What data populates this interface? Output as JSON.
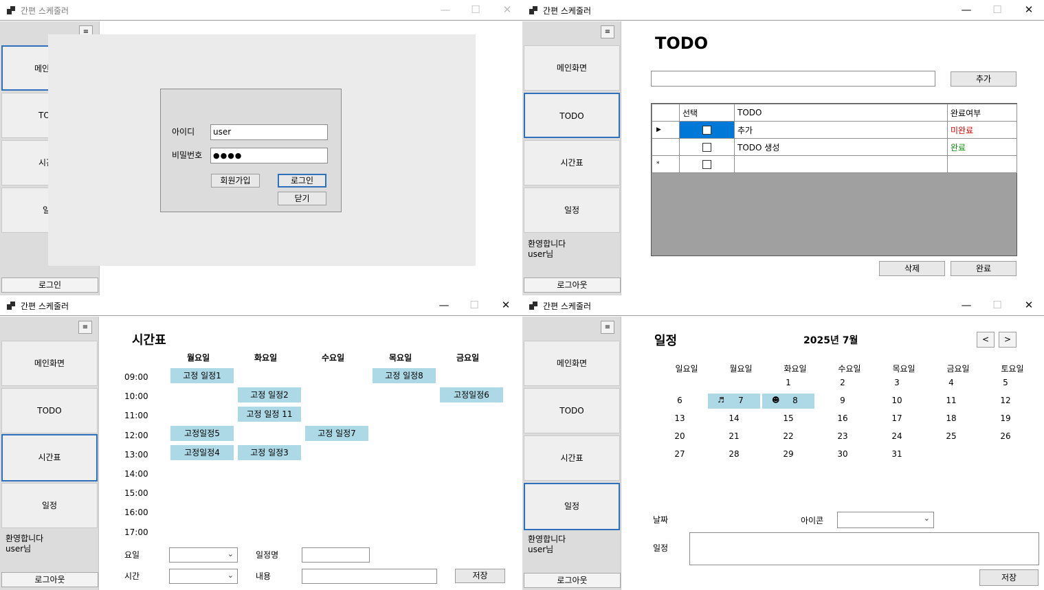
{
  "app_title": "간편 스케줄러",
  "window_buttons": {
    "minimize": "—",
    "maximize": "☐",
    "close": "✕"
  },
  "menu_button": "≡",
  "nav": [
    "메인화면",
    "TODO",
    "시간표",
    "일정"
  ],
  "nav_partial": [
    "메인",
    "TODO",
    "시간",
    "일"
  ],
  "welcome": {
    "line1": "환영합니다",
    "line2": "user님"
  },
  "login_btn": "로그인",
  "logout_btn": "로그아웃",
  "login_dialog": {
    "id_label": "아이디",
    "id_value": "user",
    "pw_label": "비밀번호",
    "pw_value": "●●●●",
    "signup": "회원가입",
    "login": "로그인",
    "close": "닫기"
  },
  "todo": {
    "title": "TODO",
    "input_value": "",
    "add_btn": "추가",
    "columns": [
      "선택",
      "TODO",
      "완료여부"
    ],
    "rows": [
      {
        "marker": "▶",
        "text": "추가",
        "status": "미완료",
        "status_color": "#d40000",
        "selected": true
      },
      {
        "marker": "",
        "text": "TODO 생성",
        "status": "완료",
        "status_color": "#108a10",
        "selected": false
      },
      {
        "marker": "*",
        "text": "",
        "status": "",
        "status_color": "#000000",
        "selected": false
      }
    ],
    "delete_btn": "삭제",
    "complete_btn": "완료"
  },
  "timetable": {
    "title": "시간표",
    "days": [
      "월요일",
      "화요일",
      "수요일",
      "목요일",
      "금요일"
    ],
    "times": [
      "09:00",
      "10:00",
      "11:00",
      "12:00",
      "13:00",
      "14:00",
      "15:00",
      "16:00",
      "17:00"
    ],
    "entries": [
      {
        "day": 0,
        "slot": 0,
        "text": "고정 일정1"
      },
      {
        "day": 3,
        "slot": 0,
        "text": "고정 일정8"
      },
      {
        "day": 1,
        "slot": 1,
        "text": "고정 일정2"
      },
      {
        "day": 4,
        "slot": 1,
        "text": "고정일정6"
      },
      {
        "day": 1,
        "slot": 2,
        "text": "고정 일정 11"
      },
      {
        "day": 0,
        "slot": 3,
        "text": "고정일정5"
      },
      {
        "day": 2,
        "slot": 3,
        "text": "고정 일정7"
      },
      {
        "day": 0,
        "slot": 4,
        "text": "고정일정4"
      },
      {
        "day": 1,
        "slot": 4,
        "text": "고정 일정3"
      }
    ],
    "day_label": "요일",
    "time_label": "시간",
    "name_label": "일정명",
    "content_label": "내용",
    "save_btn": "저장"
  },
  "calendar": {
    "title": "일정",
    "month_label": "2025년 7월",
    "prev": "<",
    "next": ">",
    "weekdays": [
      "일요일",
      "월요일",
      "화요일",
      "수요일",
      "목요일",
      "금요일",
      "토요일"
    ],
    "first_weekday": 2,
    "days_in_month": 31,
    "highlighted": [
      {
        "day": 7,
        "icon": "♬"
      },
      {
        "day": 8,
        "icon": "☻"
      }
    ],
    "date_label": "날짜",
    "icon_label": "아이콘",
    "schedule_label": "일정",
    "save_btn": "저장"
  }
}
